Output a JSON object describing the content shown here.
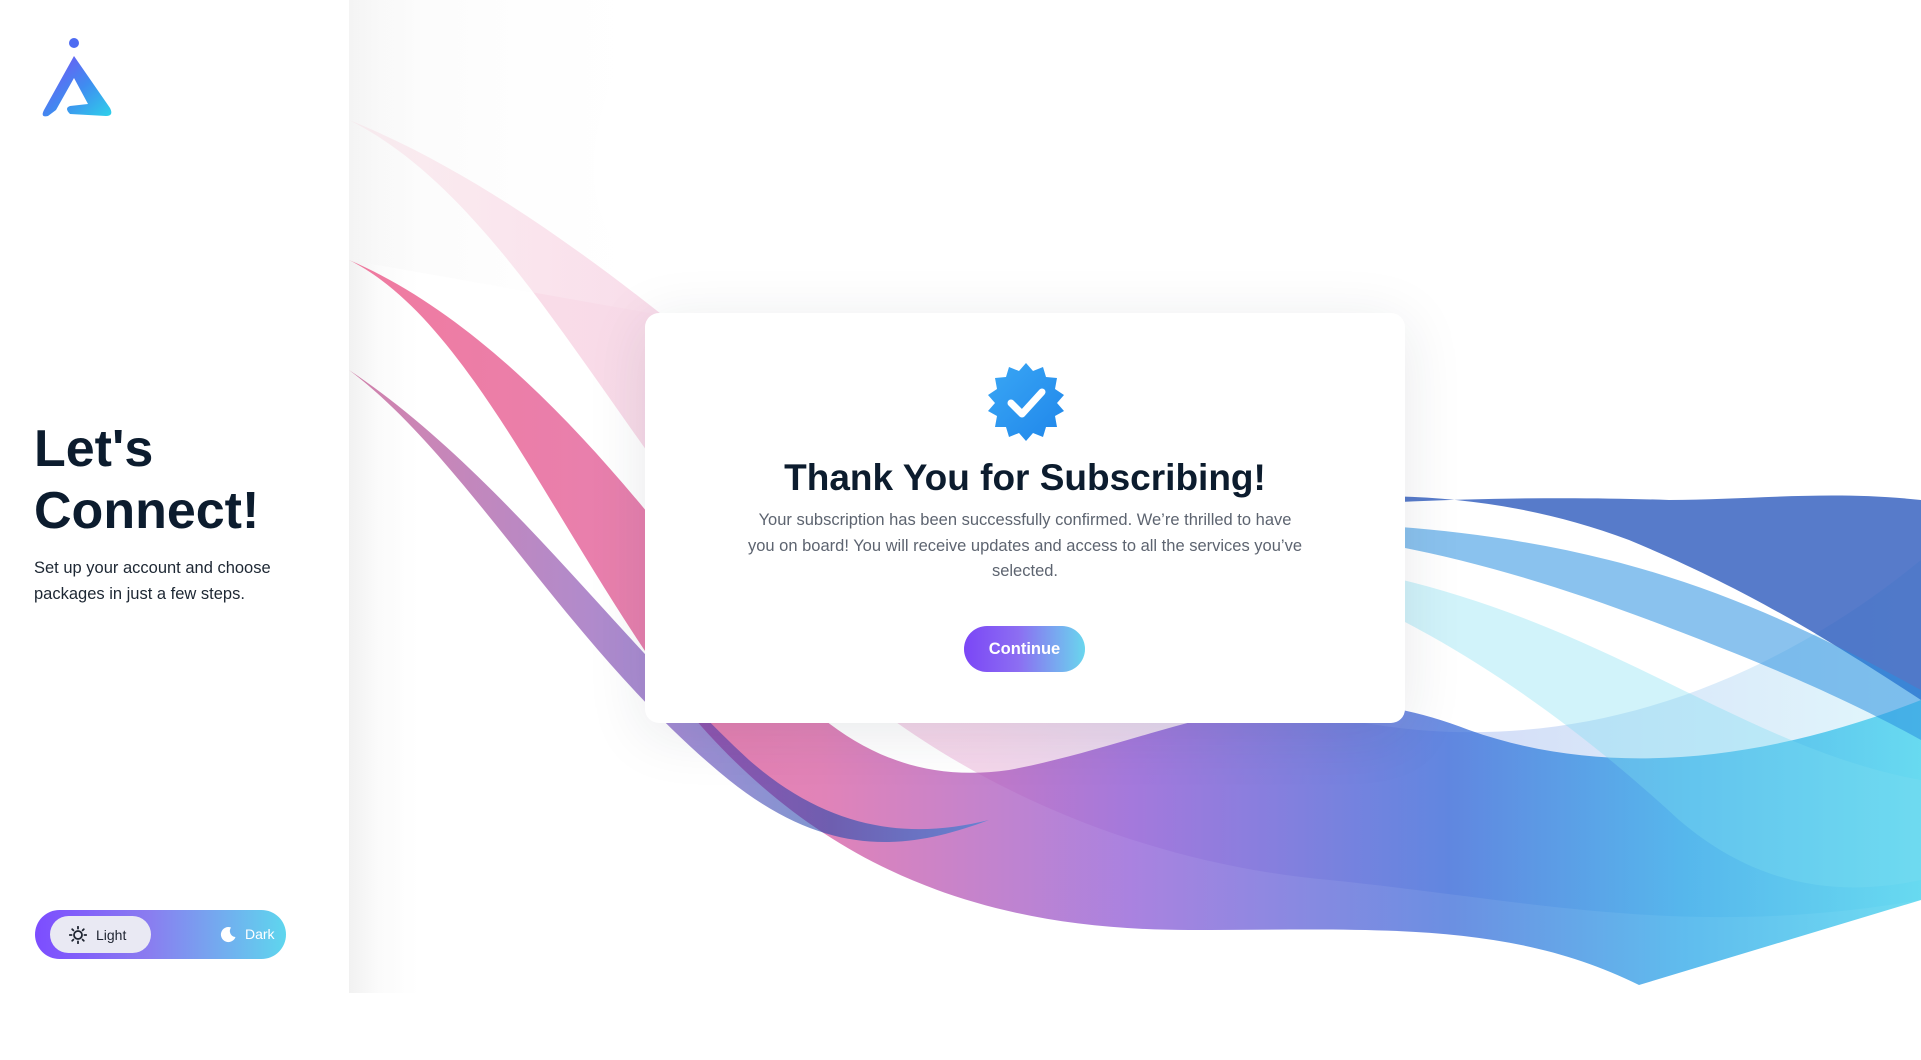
{
  "sidebar": {
    "logo_name": "brand-logo",
    "hero_title": "Let's Connect!",
    "hero_subtitle": "Set up your account and choose packages in just a few steps.",
    "theme_toggle": {
      "options": [
        {
          "label": "Light",
          "icon": "sun-icon",
          "selected": true
        },
        {
          "label": "Dark",
          "icon": "moon-icon",
          "selected": false
        }
      ]
    }
  },
  "modal": {
    "icon": "verified-badge-icon",
    "title": "Thank You for Subscribing!",
    "message": "Your subscription has been successfully confirmed. We’re thrilled to have you on board! You will receive updates and access to all the services you’ve selected.",
    "button_label": "Continue"
  },
  "colors": {
    "heading": "#0c1c2e",
    "body_text": "#5d6470",
    "accent_start": "#7b46f6",
    "accent_end": "#69d6ee",
    "badge": "#2f95f0"
  }
}
